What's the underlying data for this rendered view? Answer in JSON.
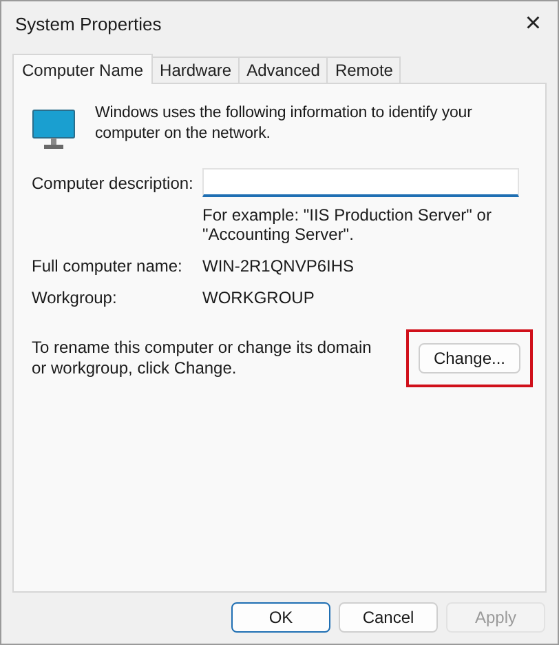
{
  "window": {
    "title": "System Properties",
    "close": "×"
  },
  "tabs": [
    {
      "label": "Computer Name",
      "selected": true
    },
    {
      "label": "Hardware",
      "selected": false
    },
    {
      "label": "Advanced",
      "selected": false
    },
    {
      "label": "Remote",
      "selected": false
    }
  ],
  "intro": "Windows uses the following information to identify your computer on the network.",
  "description": {
    "label": "Computer description:",
    "hint": "For example: \"IIS Production Server\" or \"Accounting Server\"."
  },
  "fields": [
    {
      "label": "Full computer name:",
      "value": "WIN-2R1QNVP6IHS"
    },
    {
      "label": "Workgroup:",
      "value": "WORKGROUP"
    }
  ],
  "rename": {
    "text": "To rename this computer or change its domain or workgroup, click Change.",
    "button": "Change...",
    "highlighted": true
  },
  "buttons": [
    {
      "label": "OK",
      "default": true,
      "disabled": false
    },
    {
      "label": "Cancel",
      "default": false,
      "disabled": false
    },
    {
      "label": "Apply",
      "default": false,
      "disabled": true
    }
  ]
}
